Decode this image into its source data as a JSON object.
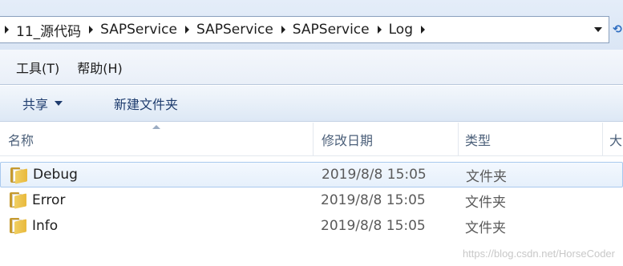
{
  "address_bar": {
    "breadcrumbs": [
      "11_源代码",
      "SAPService",
      "SAPService",
      "SAPService",
      "Log"
    ]
  },
  "menu": {
    "items": [
      "工具(T)",
      "帮助(H)"
    ]
  },
  "command_bar": {
    "share_label": "共享",
    "new_folder_label": "新建文件夹"
  },
  "columns": {
    "name": "名称",
    "date_modified": "修改日期",
    "type": "类型",
    "size": "大"
  },
  "files": [
    {
      "name": "Debug",
      "date": "2019/8/8 15:05",
      "type": "文件夹",
      "selected": true
    },
    {
      "name": "Error",
      "date": "2019/8/8 15:05",
      "type": "文件夹",
      "selected": false
    },
    {
      "name": "Info",
      "date": "2019/8/8 15:05",
      "type": "文件夹",
      "selected": false
    }
  ],
  "watermark": "https://blog.csdn.net/HorseCoder",
  "colors": {
    "accent": "#a9c9ee",
    "folder": "#f0cf62",
    "command_text": "#1e3c6e"
  }
}
